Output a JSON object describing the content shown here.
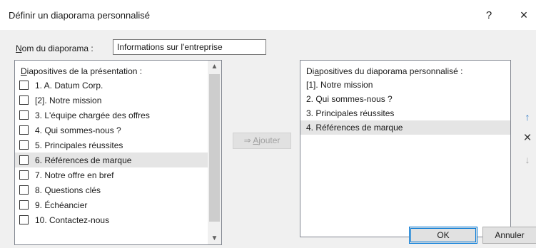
{
  "dialog": {
    "title": "Définir un diaporama personnalisé",
    "help": "?",
    "close": "×"
  },
  "name_field": {
    "label_prefix": "N",
    "label_rest": "om du diaporama :",
    "value": "Informations sur l'entreprise"
  },
  "presentation_slides": {
    "header_prefix": "D",
    "header_rest": "iapositives de la présentation :",
    "items": [
      {
        "label": "1. A. Datum Corp."
      },
      {
        "label": "[2]. Notre mission"
      },
      {
        "label": "3. L'équipe chargée des offres"
      },
      {
        "label": "4. Qui sommes-nous ?"
      },
      {
        "label": "5. Principales réussites"
      },
      {
        "label": "6. Références de marque"
      },
      {
        "label": "7. Notre offre en bref"
      },
      {
        "label": "8. Questions clés"
      },
      {
        "label": "9. Échéancier"
      },
      {
        "label": "10. Contactez-nous"
      }
    ],
    "selected_index": 5
  },
  "add_button": {
    "arrow": "⇒",
    "label_prefix": "A",
    "label_rest": "jouter"
  },
  "custom_slides": {
    "header_prefix": "Di",
    "header_underlined": "a",
    "header_rest": "positives du diaporama personnalisé :",
    "items": [
      {
        "label": "[1]. Notre mission"
      },
      {
        "label": "2. Qui sommes-nous ?"
      },
      {
        "label": "3. Principales réussites"
      },
      {
        "label": "4. Références de marque"
      }
    ],
    "selected_index": 3
  },
  "side_buttons": {
    "up": "↑",
    "delete": "×",
    "down": "↓"
  },
  "ok_label": "OK",
  "cancel_label": "Annuler",
  "icons": {
    "close": "close-icon",
    "up": "arrow-up-icon",
    "delete": "delete-x-icon",
    "down": "arrow-down-icon",
    "add": "add-arrow-icon"
  },
  "colors": {
    "accent": "#0078d7",
    "selection": "#e5e5e5",
    "dialog_bg": "#f0f0f0"
  }
}
